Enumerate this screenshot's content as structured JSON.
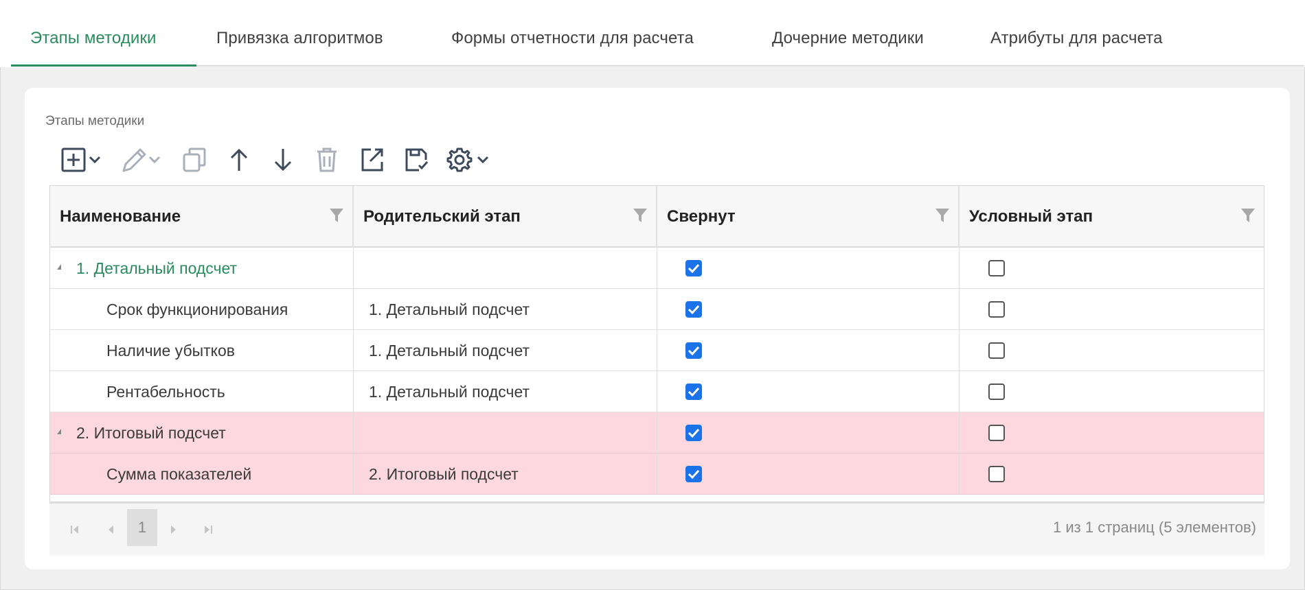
{
  "tabs": [
    {
      "label": "Этапы методики",
      "active": true
    },
    {
      "label": "Привязка алгоритмов",
      "active": false
    },
    {
      "label": "Формы отчетности для расчета",
      "active": false
    },
    {
      "label": "Дочерние методики",
      "active": false
    },
    {
      "label": "Атрибуты для расчета",
      "active": false
    }
  ],
  "grid": {
    "title": "Этапы методики",
    "toolbar": [
      "add-icon",
      "edit-icon",
      "copy-icon",
      "arrow-up-icon",
      "arrow-down-icon",
      "delete-icon",
      "export-icon",
      "save-icon",
      "settings-icon"
    ],
    "columns": [
      "Наименование",
      "Родительский этап",
      "Свернут",
      "Условный этап"
    ],
    "rows": [
      {
        "name": "1. Детальный подсчет",
        "parent": "",
        "collapsed": true,
        "conditional": false,
        "group": true,
        "error": false
      },
      {
        "name": "Срок функционирования",
        "parent": "1. Детальный подсчет",
        "collapsed": true,
        "conditional": false,
        "group": false,
        "error": false
      },
      {
        "name": "Наличие убытков",
        "parent": "1. Детальный подсчет",
        "collapsed": true,
        "conditional": false,
        "group": false,
        "error": false
      },
      {
        "name": "Рентабельность",
        "parent": "1. Детальный подсчет",
        "collapsed": true,
        "conditional": false,
        "group": false,
        "error": false
      },
      {
        "name": "2. Итоговый подсчет",
        "parent": "",
        "collapsed": true,
        "conditional": false,
        "group": true,
        "error": true
      },
      {
        "name": "Сумма показателей",
        "parent": "2. Итоговый подсчет",
        "collapsed": true,
        "conditional": false,
        "group": false,
        "error": true
      }
    ]
  },
  "pager": {
    "current_page": "1",
    "info": "1 из 1 страниц (5 элементов)"
  },
  "colors": {
    "accent": "#2b8a5e",
    "checkbox": "#1a73e8",
    "error_row": "#fdd9df"
  }
}
